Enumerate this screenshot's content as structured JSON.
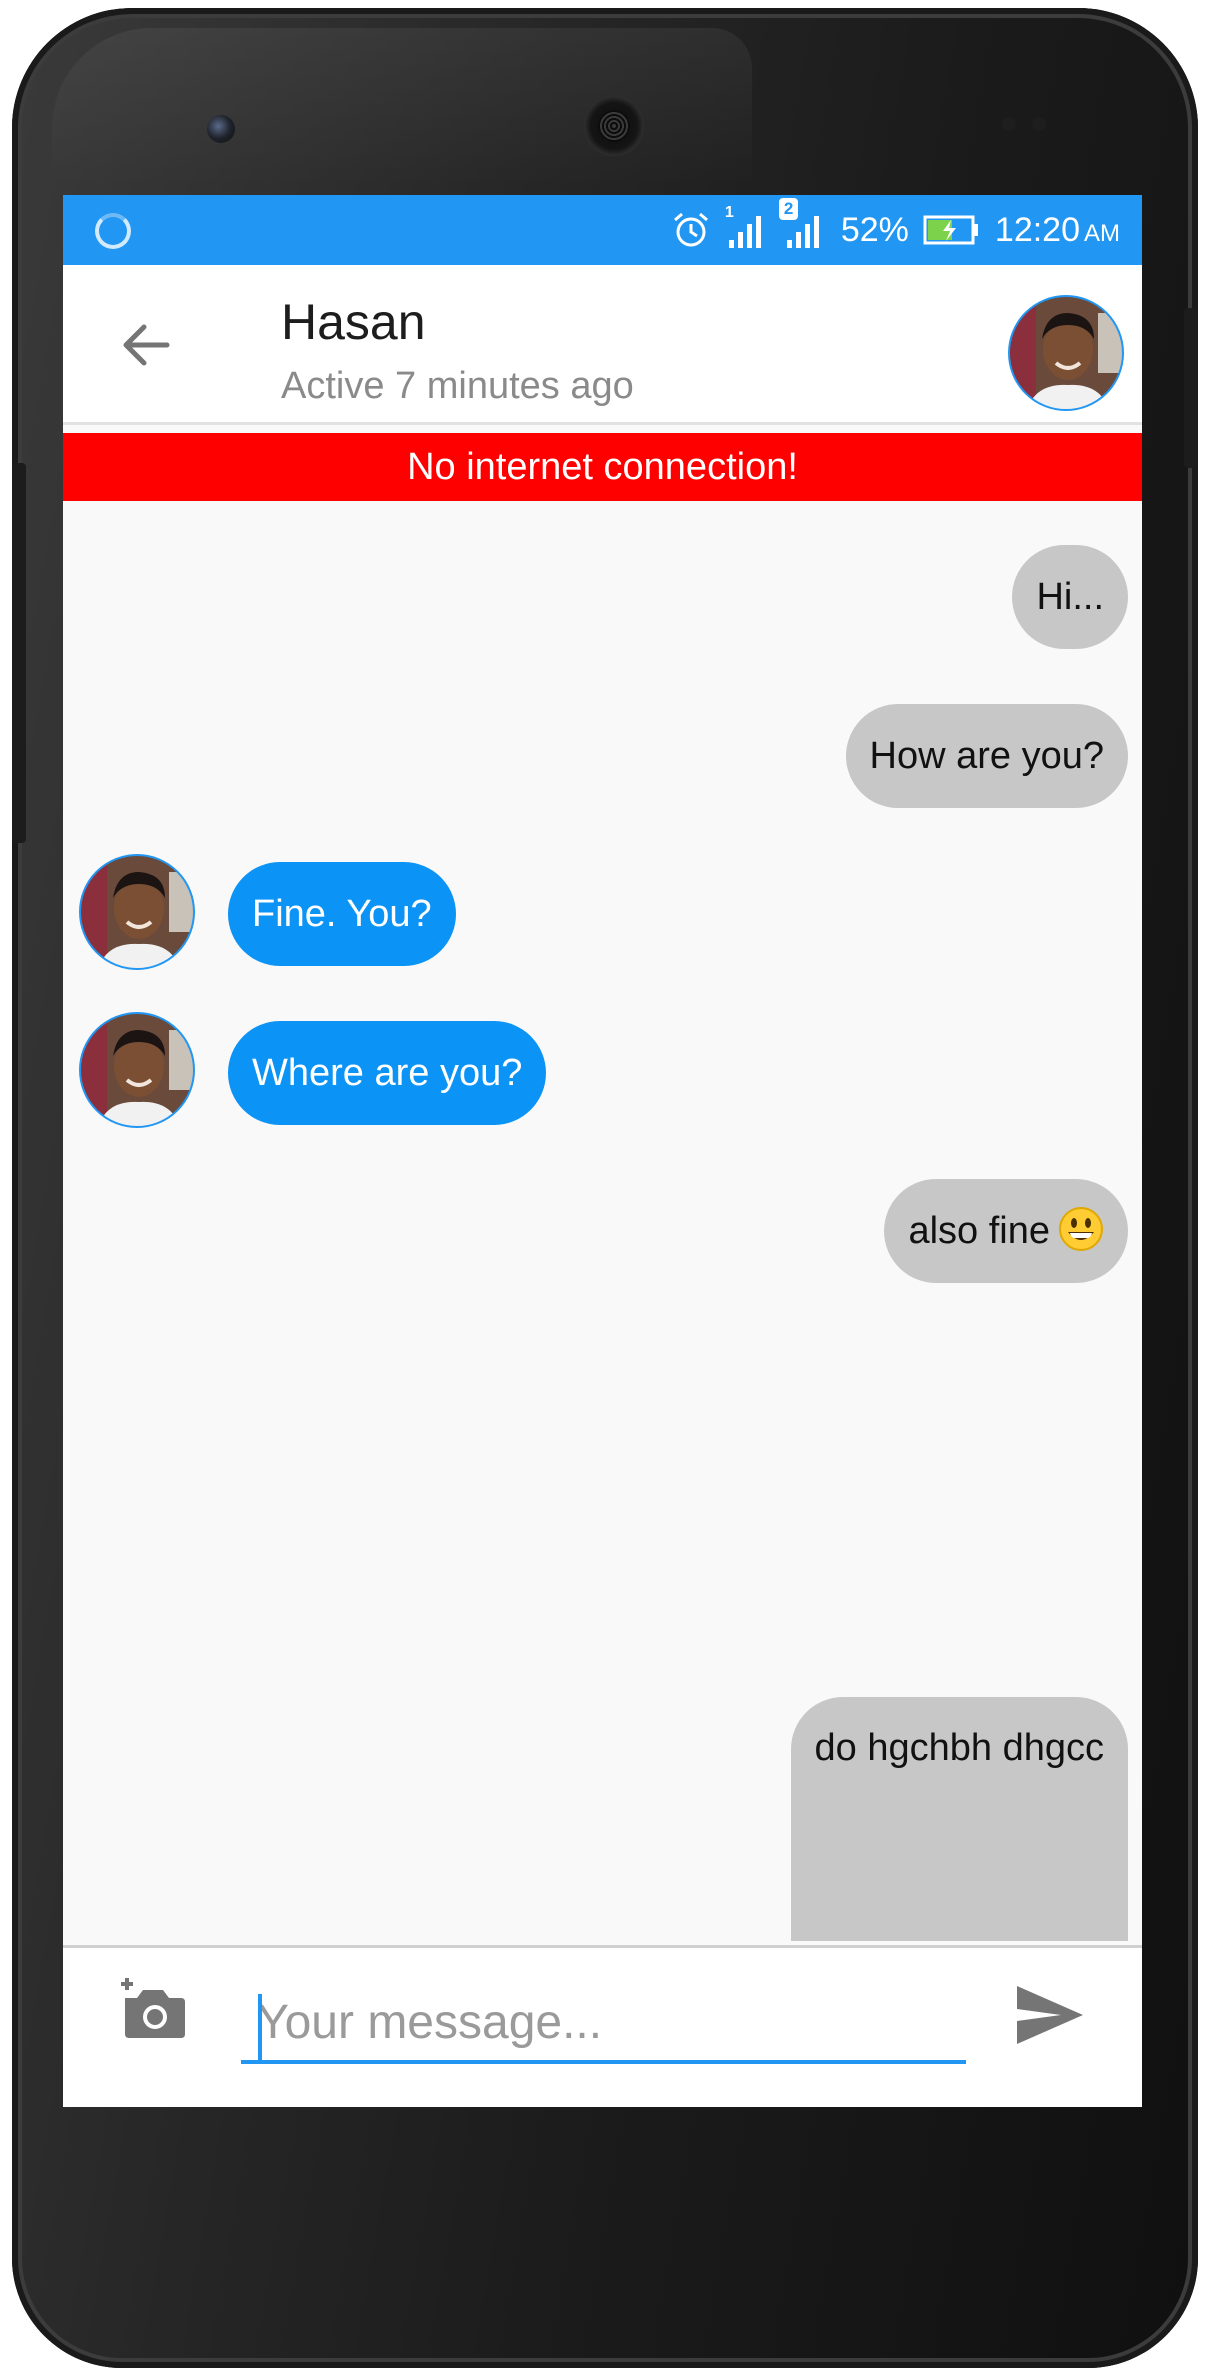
{
  "status_bar": {
    "sim1_label": "1",
    "sim2_label": "2",
    "battery": "52%",
    "time": "12:20",
    "ampm": "AM",
    "icons": [
      "loading-spinner-icon",
      "alarm-clock-icon",
      "signal-icon",
      "battery-charging-icon"
    ],
    "color": "#2196f3"
  },
  "header": {
    "contact_name": "Hasan",
    "contact_status": "Active 7 minutes ago",
    "back_icon": "arrow-left-icon"
  },
  "banner": {
    "text": "No internet connection!",
    "color": "#ff0000"
  },
  "messages": [
    {
      "direction": "outgoing",
      "text": "Hi..."
    },
    {
      "direction": "outgoing",
      "text": "How are you?"
    },
    {
      "direction": "incoming",
      "text": "Fine. You?"
    },
    {
      "direction": "incoming",
      "text": "Where are you?"
    },
    {
      "direction": "outgoing",
      "text": "also fine",
      "emoji": "grinning-face"
    },
    {
      "direction": "outgoing",
      "text": "do hgchbh dhgcc"
    }
  ],
  "colors": {
    "incoming_bubble": "#0b93f6",
    "outgoing_bubble": "#c7c7c7"
  },
  "compose": {
    "placeholder": "Your message...",
    "value": "",
    "camera_icon": "add-photo-camera-icon",
    "send_icon": "send-icon"
  }
}
